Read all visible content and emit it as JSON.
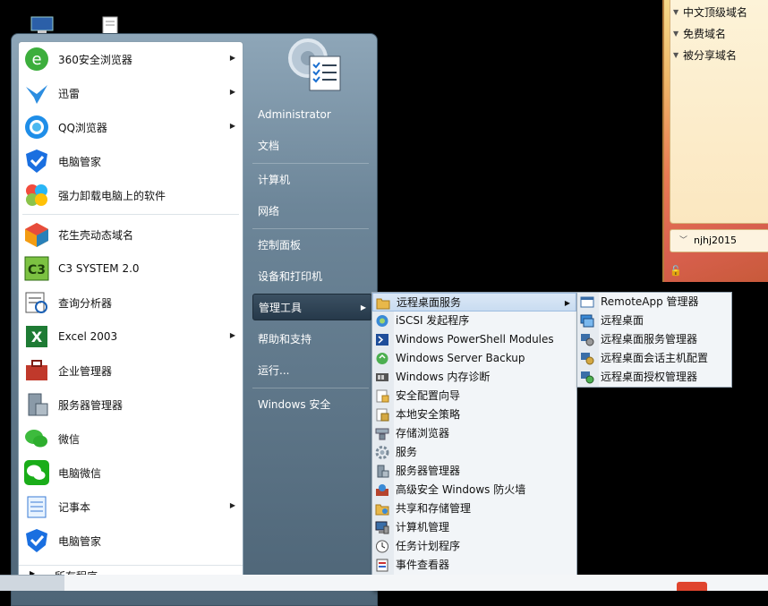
{
  "widget": {
    "items": [
      "中文顶级域名",
      "免费域名",
      "被分享域名"
    ],
    "username": "njhj2015"
  },
  "start_menu": {
    "programs": [
      {
        "label": "360安全浏览器",
        "icon": "ie360-icon",
        "has_sub": true
      },
      {
        "label": "迅雷",
        "icon": "xunlei-icon",
        "has_sub": true
      },
      {
        "label": "QQ浏览器",
        "icon": "qq-browser-icon",
        "has_sub": true
      },
      {
        "label": "电脑管家",
        "icon": "pc-manager-icon",
        "has_sub": false
      },
      {
        "label": "强力卸载电脑上的软件",
        "icon": "uninstall-icon",
        "has_sub": false
      },
      {
        "label": "花生壳动态域名",
        "icon": "peanut-shell-icon",
        "has_sub": false
      },
      {
        "label": "C3 SYSTEM 2.0",
        "icon": "c3-system-icon",
        "has_sub": false
      },
      {
        "label": "查询分析器",
        "icon": "query-analyzer-icon",
        "has_sub": false
      },
      {
        "label": "Excel 2003",
        "icon": "excel-icon",
        "has_sub": true
      },
      {
        "label": "企业管理器",
        "icon": "enterprise-manager-icon",
        "has_sub": false
      },
      {
        "label": "服务器管理器",
        "icon": "server-manager-icon",
        "has_sub": false
      },
      {
        "label": "微信",
        "icon": "wechat-icon",
        "has_sub": false
      },
      {
        "label": "电脑微信",
        "icon": "pc-wechat-icon",
        "has_sub": false
      },
      {
        "label": "记事本",
        "icon": "notepad-icon",
        "has_sub": true
      },
      {
        "label": "电脑管家",
        "icon": "pc-manager-icon",
        "has_sub": false
      }
    ],
    "all_programs": "所有程序",
    "right_items": [
      {
        "label": "Administrator"
      },
      {
        "label": "文档"
      },
      {
        "label": "计算机"
      },
      {
        "label": "网络"
      },
      {
        "label": "控制面板"
      },
      {
        "label": "设备和打印机"
      },
      {
        "label": "管理工具",
        "active": true,
        "has_sub": true
      },
      {
        "label": "帮助和支持"
      },
      {
        "label": "运行..."
      },
      {
        "label": "Windows 安全"
      }
    ]
  },
  "admin_tools": {
    "items": [
      {
        "label": "远程桌面服务",
        "icon": "folder-icon",
        "has_sub": true,
        "active": true
      },
      {
        "label": "iSCSI 发起程序",
        "icon": "iscsi-icon"
      },
      {
        "label": "Windows PowerShell Modules",
        "icon": "powershell-icon"
      },
      {
        "label": "Windows Server Backup",
        "icon": "backup-icon"
      },
      {
        "label": "Windows 内存诊断",
        "icon": "memory-diagnostic-icon"
      },
      {
        "label": "安全配置向导",
        "icon": "security-wizard-icon"
      },
      {
        "label": "本地安全策略",
        "icon": "local-policy-icon"
      },
      {
        "label": "存储浏览器",
        "icon": "storage-explorer-icon"
      },
      {
        "label": "服务",
        "icon": "services-icon"
      },
      {
        "label": "服务器管理器",
        "icon": "server-manager-icon"
      },
      {
        "label": "高级安全 Windows 防火墙",
        "icon": "firewall-icon"
      },
      {
        "label": "共享和存储管理",
        "icon": "share-storage-icon"
      },
      {
        "label": "计算机管理",
        "icon": "computer-management-icon"
      },
      {
        "label": "任务计划程序",
        "icon": "task-scheduler-icon"
      },
      {
        "label": "事件查看器",
        "icon": "event-viewer-icon"
      }
    ]
  },
  "rds_menu": {
    "items": [
      {
        "label": "RemoteApp 管理器",
        "icon": "remoteapp-icon"
      },
      {
        "label": "远程桌面",
        "icon": "remote-desktop-icon"
      },
      {
        "label": "远程桌面服务管理器",
        "icon": "rds-manager-icon"
      },
      {
        "label": "远程桌面会话主机配置",
        "icon": "session-host-icon"
      },
      {
        "label": "远程桌面授权管理器",
        "icon": "licensing-icon"
      }
    ]
  }
}
